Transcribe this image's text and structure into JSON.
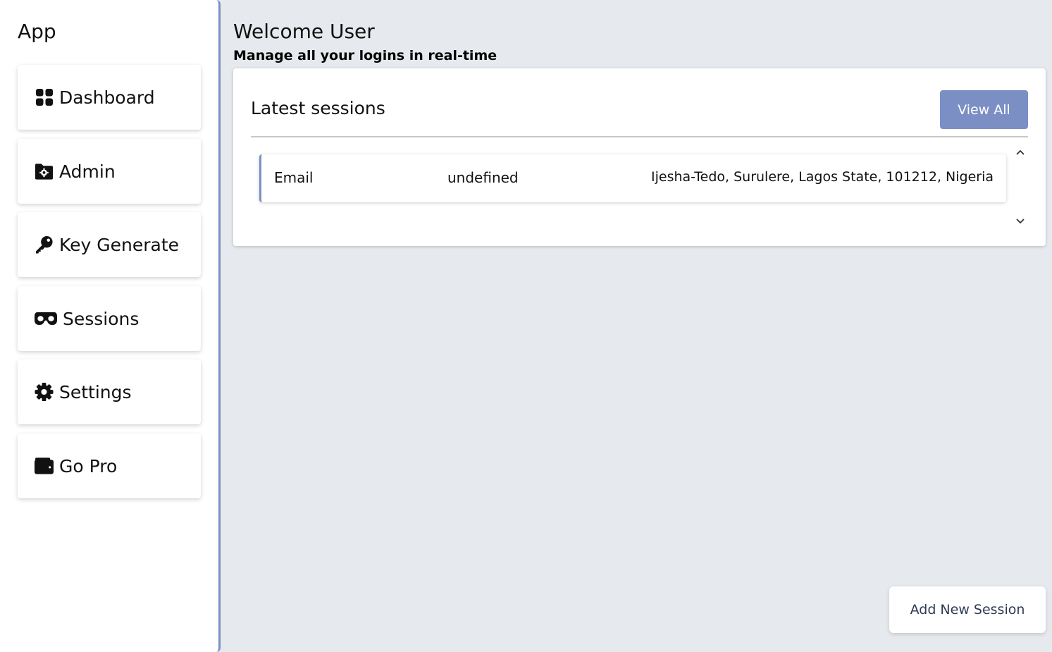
{
  "app": {
    "title": "App"
  },
  "sidebar": {
    "items": [
      {
        "label": "Dashboard",
        "icon": "dashboard-grid-icon"
      },
      {
        "label": "Admin",
        "icon": "folder-gear-icon"
      },
      {
        "label": "Key Generate",
        "icon": "key-icon"
      },
      {
        "label": "Sessions",
        "icon": "mask-icon"
      },
      {
        "label": "Settings",
        "icon": "gear-icon"
      },
      {
        "label": "Go Pro",
        "icon": "wallet-icon"
      }
    ]
  },
  "header": {
    "title": "Welcome User",
    "subtitle": "Manage all your logins in real-time"
  },
  "sessions_card": {
    "title": "Latest sessions",
    "view_all_label": "View All",
    "rows": [
      {
        "type": "Email",
        "device": "undefined",
        "location": "Ijesha-Tedo, Surulere, Lagos State, 101212, Nigeria"
      }
    ]
  },
  "footer": {
    "add_session_label": "Add New Session"
  },
  "colors": {
    "accent": "#7b8fc4",
    "background": "#e6e9ed",
    "surface": "#ffffff",
    "button_text_dark": "#2d3b55"
  }
}
